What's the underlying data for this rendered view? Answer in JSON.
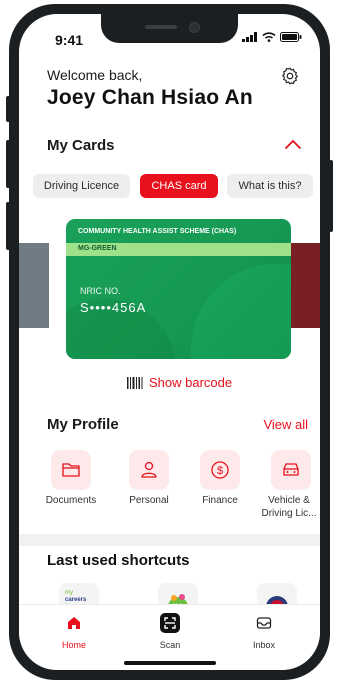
{
  "status_bar": {
    "time": "9:41"
  },
  "header": {
    "welcome": "Welcome back,",
    "user_name": "Joey Chan Hsiao An"
  },
  "my_cards": {
    "title": "My Cards",
    "tabs": [
      "Driving Licence",
      "CHAS card",
      "What is this?"
    ],
    "selected_tab": "CHAS card",
    "card": {
      "scheme": "COMMUNITY HEALTH ASSIST SCHEME (CHAS)",
      "tier": "MG-GREEN",
      "nric_label": "NRIC NO.",
      "nric": "S••••456A"
    },
    "barcode_label": "Show barcode"
  },
  "my_profile": {
    "title": "My Profile",
    "view_all": "View all",
    "items": [
      {
        "label": "Documents",
        "icon": "folder-icon"
      },
      {
        "label": "Personal",
        "icon": "person-icon"
      },
      {
        "label": "Finance",
        "icon": "dollar-icon"
      },
      {
        "label": "Vehicle & Driving Lic...",
        "icon": "car-icon"
      }
    ]
  },
  "shortcuts": {
    "title": "Last used shortcuts",
    "items": [
      {
        "icon": "mycareersfuture-icon"
      },
      {
        "icon": "healthhub-icon"
      },
      {
        "icon": "government-crest-icon"
      }
    ]
  },
  "bottom_nav": {
    "items": [
      {
        "label": "Home",
        "icon": "home-icon",
        "active": true
      },
      {
        "label": "Scan",
        "icon": "scan-icon",
        "active": false
      },
      {
        "label": "Inbox",
        "icon": "inbox-icon",
        "active": false
      }
    ]
  },
  "colors": {
    "accent": "#e8101c",
    "card_green": "#169a53",
    "card_band": "#9fe08b"
  }
}
